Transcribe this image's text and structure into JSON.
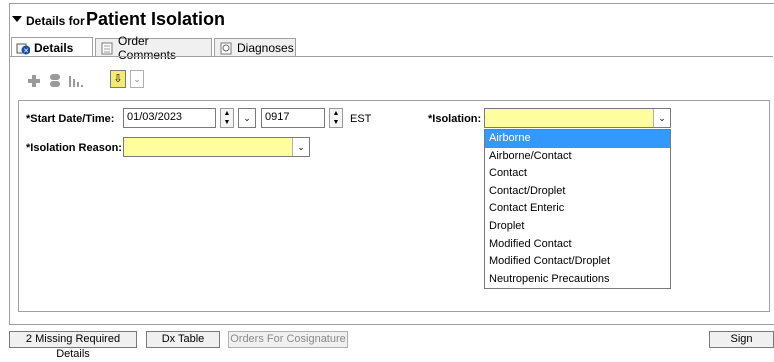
{
  "header": {
    "small": "Details for",
    "big": "Patient Isolation"
  },
  "tabs": [
    {
      "label": "Details",
      "active": true,
      "icon": "details-icon"
    },
    {
      "label": "Order Comments",
      "active": false,
      "icon": "comments-icon"
    },
    {
      "label": "Diagnoses",
      "active": false,
      "icon": "diagnoses-icon"
    }
  ],
  "toolbar": {
    "icons": [
      "add-icon",
      "pill-icon",
      "bar-chart-icon",
      "down-arrow-icon",
      "chevron-down-icon"
    ],
    "yellow_glyph": "⇩",
    "dd_glyph": "⌄"
  },
  "form": {
    "start_label": "*Start Date/Time:",
    "start_date": "01/03/2023",
    "start_time": "0917",
    "timezone": "EST",
    "isolation_label": "*Isolation:",
    "isolation_value": "",
    "reason_label": "*Isolation Reason:",
    "reason_value": ""
  },
  "isolation_options": [
    "Airborne",
    "Airborne/Contact",
    "Contact",
    "Contact/Droplet",
    "Contact Enteric",
    "Droplet",
    "Modified Contact",
    "Modified Contact/Droplet",
    "Neutropenic Precautions"
  ],
  "selected_option_index": 0,
  "statusbar": {
    "missing": "2 Missing Required Details",
    "dx_table": "Dx Table",
    "orders_cosign": "Orders For Cosignature",
    "sign": "Sign"
  },
  "colors": {
    "required_field": "#fffe9e",
    "selected": "#3399ff"
  }
}
